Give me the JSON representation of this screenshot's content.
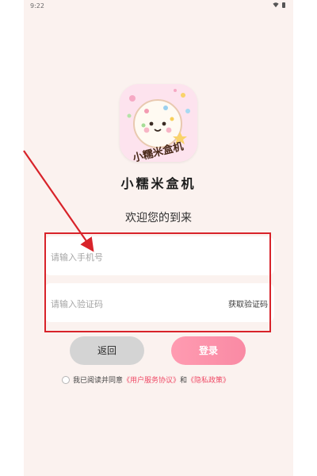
{
  "status_bar": {
    "time": "9:22",
    "wifi_icon": "wifi-icon",
    "battery_icon": "battery-icon"
  },
  "app": {
    "name": "小糯米盒机",
    "logo_text": "小糯米盒机",
    "logo_icon": "rice-ball-mascot-icon"
  },
  "welcome_text": "欢迎您的到来",
  "form": {
    "phone_placeholder": "请输入手机号",
    "code_placeholder": "请输入验证码",
    "get_code_label": "获取验证码"
  },
  "buttons": {
    "back": "返回",
    "login": "登录"
  },
  "agreement": {
    "prefix": "我已阅读并同意",
    "user_agreement": "《用户服务协议》",
    "and": "和",
    "privacy_policy": "《隐私政策》"
  },
  "colors": {
    "background": "#fbf2ef",
    "accent_pink": "#f98aa4",
    "link": "#ef4a66",
    "annotation_red": "#d8232a"
  }
}
